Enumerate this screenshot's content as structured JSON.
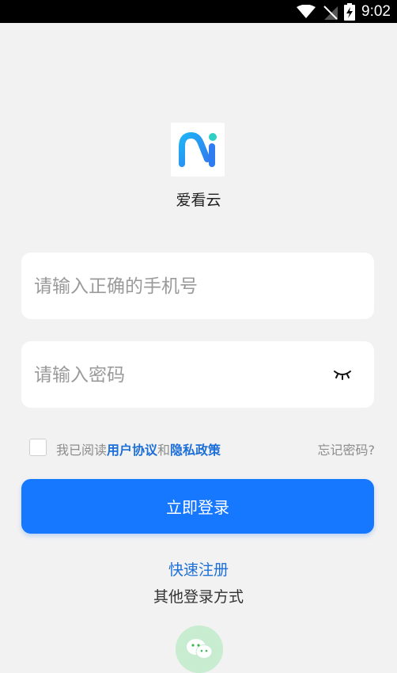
{
  "status_bar": {
    "time": "9:02",
    "icons": [
      "wifi-icon",
      "no-sim-icon",
      "battery-charging-icon"
    ]
  },
  "app": {
    "name": "爱看云",
    "logo_colors": [
      "#1fb2f5",
      "#2f7cf0",
      "#2ecfc4"
    ]
  },
  "login_form": {
    "phone_placeholder": "请输入正确的手机号",
    "password_placeholder": "请输入密码",
    "password_toggle_icon": "eye-closed-icon",
    "agreement_prefix": "我已阅读",
    "user_agreement_link": "用户协议",
    "agreement_and": "和",
    "privacy_policy_link": "隐私政策",
    "forgot_password": "忘记密码?",
    "login_button": "立即登录",
    "quick_register": "快速注册",
    "other_login_methods": "其他登录方式",
    "wechat_icon": "wechat-icon"
  },
  "colors": {
    "primary": "#1677ff",
    "link": "#1d6fd8",
    "background": "#f2f2f2"
  }
}
